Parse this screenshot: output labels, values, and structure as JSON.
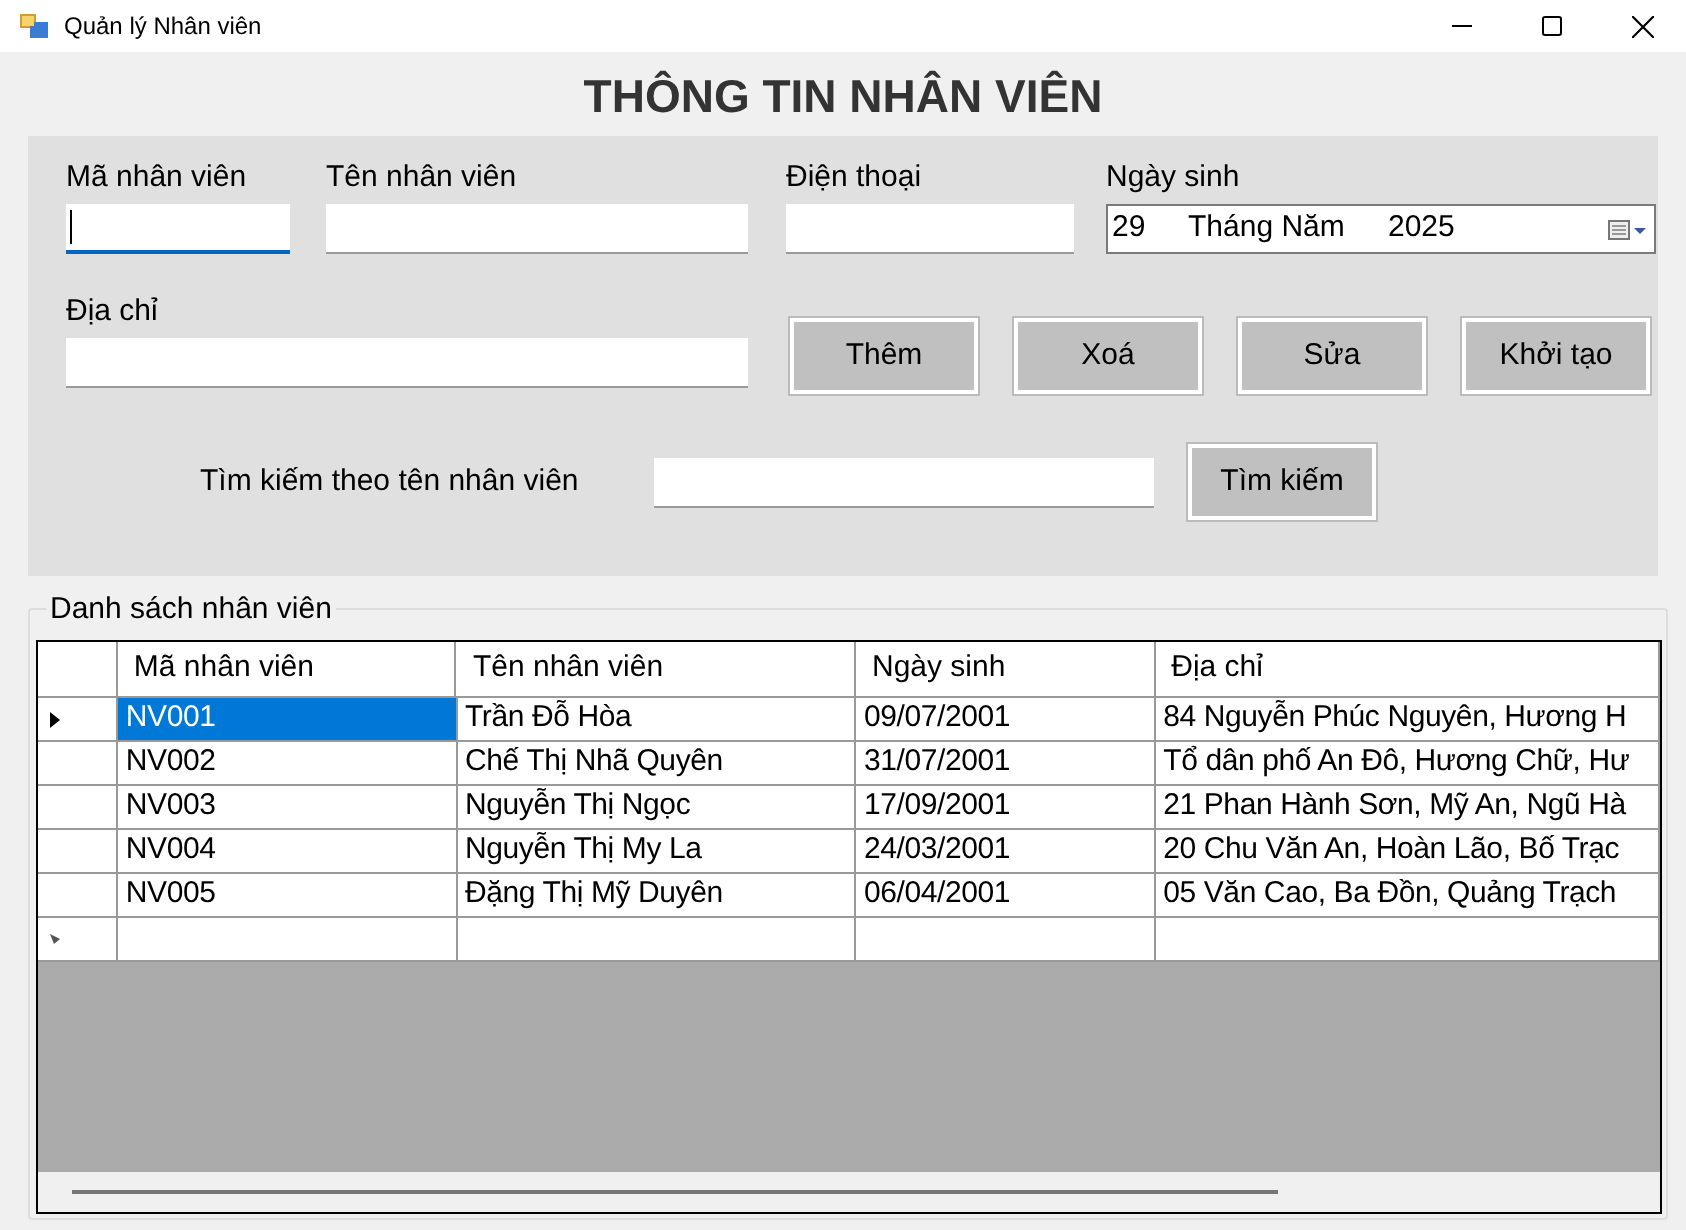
{
  "window": {
    "title": "Quản lý Nhân viên"
  },
  "heading": "THÔNG TIN NHÂN VIÊN",
  "fields": [
    {
      "label": "Mã nhân viên",
      "focused": true
    },
    {
      "label": "Tên nhân viên",
      "focused": false
    },
    {
      "label": "Điện thoại",
      "focused": false
    }
  ],
  "birth_date": {
    "label": "Ngày sinh",
    "day": "29",
    "month": "Tháng Năm",
    "year": "2025"
  },
  "address": {
    "label": "Địa chỉ",
    "focused": false
  },
  "buttons": [
    "Thêm",
    "Xoá",
    "Sửa",
    "Khởi tạo"
  ],
  "search": {
    "label": "Tìm kiếm theo tên nhân viên",
    "button": "Tìm kiếm"
  },
  "table": {
    "title": "Danh sách nhân viên",
    "columns": [
      "Mã nhân viên",
      "Tên nhân viên",
      "Ngày sinh",
      "Địa chỉ"
    ],
    "rows": [
      {
        "selected": true,
        "cells": [
          "NV001",
          "Trần Đỗ Hòa",
          "09/07/2001",
          "84 Nguyễn Phúc Nguyên, Hương H"
        ]
      },
      {
        "selected": false,
        "cells": [
          "NV002",
          "Chế Thị Nhã Quyên",
          "31/07/2001",
          "Tổ dân phố An Đô, Hương Chữ, Hư"
        ]
      },
      {
        "selected": false,
        "cells": [
          "NV003",
          "Nguyễn Thị Ngọc",
          "17/09/2001",
          "21 Phan Hành Sơn, Mỹ An, Ngũ Hà"
        ]
      },
      {
        "selected": false,
        "cells": [
          "NV004",
          "Nguyễn Thị My La",
          "24/03/2001",
          "20 Chu Văn An, Hoàn Lão, Bố Trạc"
        ]
      },
      {
        "selected": false,
        "cells": [
          "NV005",
          "Đặng Thị Mỹ Duyên",
          "06/04/2001",
          "05 Văn Cao, Ba Đồn, Quảng Trạch"
        ]
      }
    ]
  }
}
